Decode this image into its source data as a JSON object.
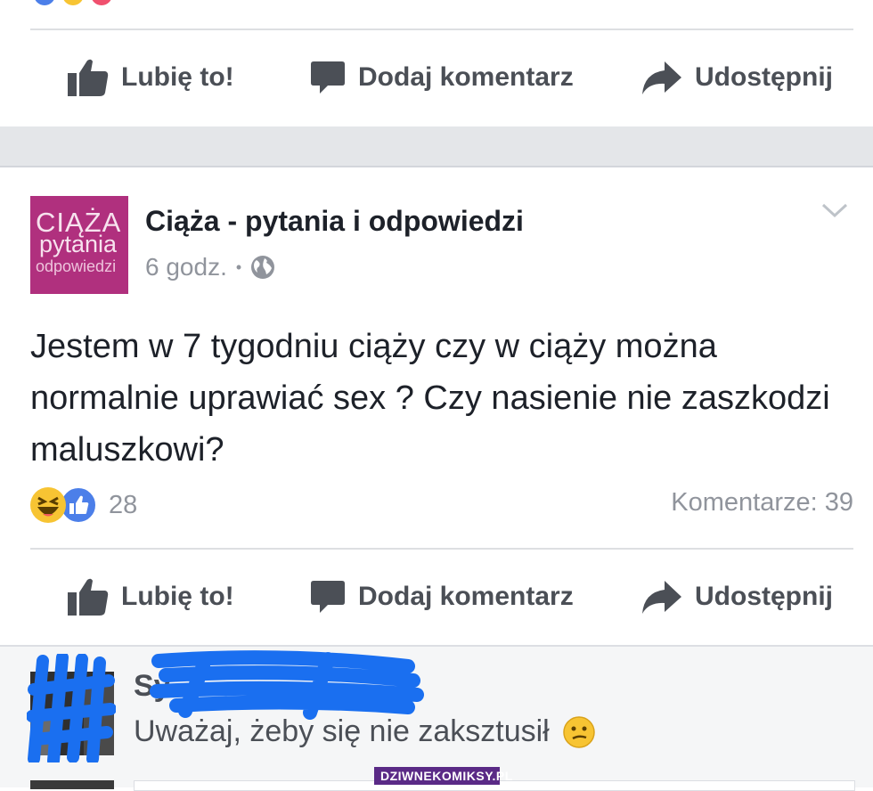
{
  "top_actions": {
    "like_label": "Lubię to!",
    "comment_label": "Dodaj komentarz",
    "share_label": "Udostępnij"
  },
  "post": {
    "page_logo": {
      "line1": "CIĄŻA",
      "line2": "pytania",
      "line3": "odpowiedzi"
    },
    "page_name": "Ciąża - pytania i odpowiedzi",
    "time": "6 godz.",
    "separator": "•",
    "privacy_icon": "globe-icon",
    "menu_icon": "chevron-down-icon",
    "text": "Jestem w 7 tygodniu ciąży czy w ciąży można normalnie uprawiać sex ? Czy nasienie nie zaszkodzi maluszkowi?",
    "reaction_icons": [
      "haha-reaction-icon",
      "like-reaction-icon"
    ],
    "reaction_count": "28",
    "comments_count": "Komentarze: 39"
  },
  "bottom_actions": {
    "like_label": "Lubię to!",
    "comment_label": "Dodaj komentarz",
    "share_label": "Udostępnij"
  },
  "comment": {
    "author_visible": "Sy",
    "text": "Uważaj, żeby się nie zaksztusił",
    "emoji_icon": "confused-face-icon"
  },
  "watermark": "DZIWNEKOMIKSY.PL",
  "colors": {
    "page_logo_bg": "#b0307e",
    "link_blue": "#4267b2",
    "action_grey": "#4b4f56",
    "meta_grey": "#90949c",
    "scribble_blue": "#1a6ff0",
    "watermark_bg": "#5a2a86"
  }
}
